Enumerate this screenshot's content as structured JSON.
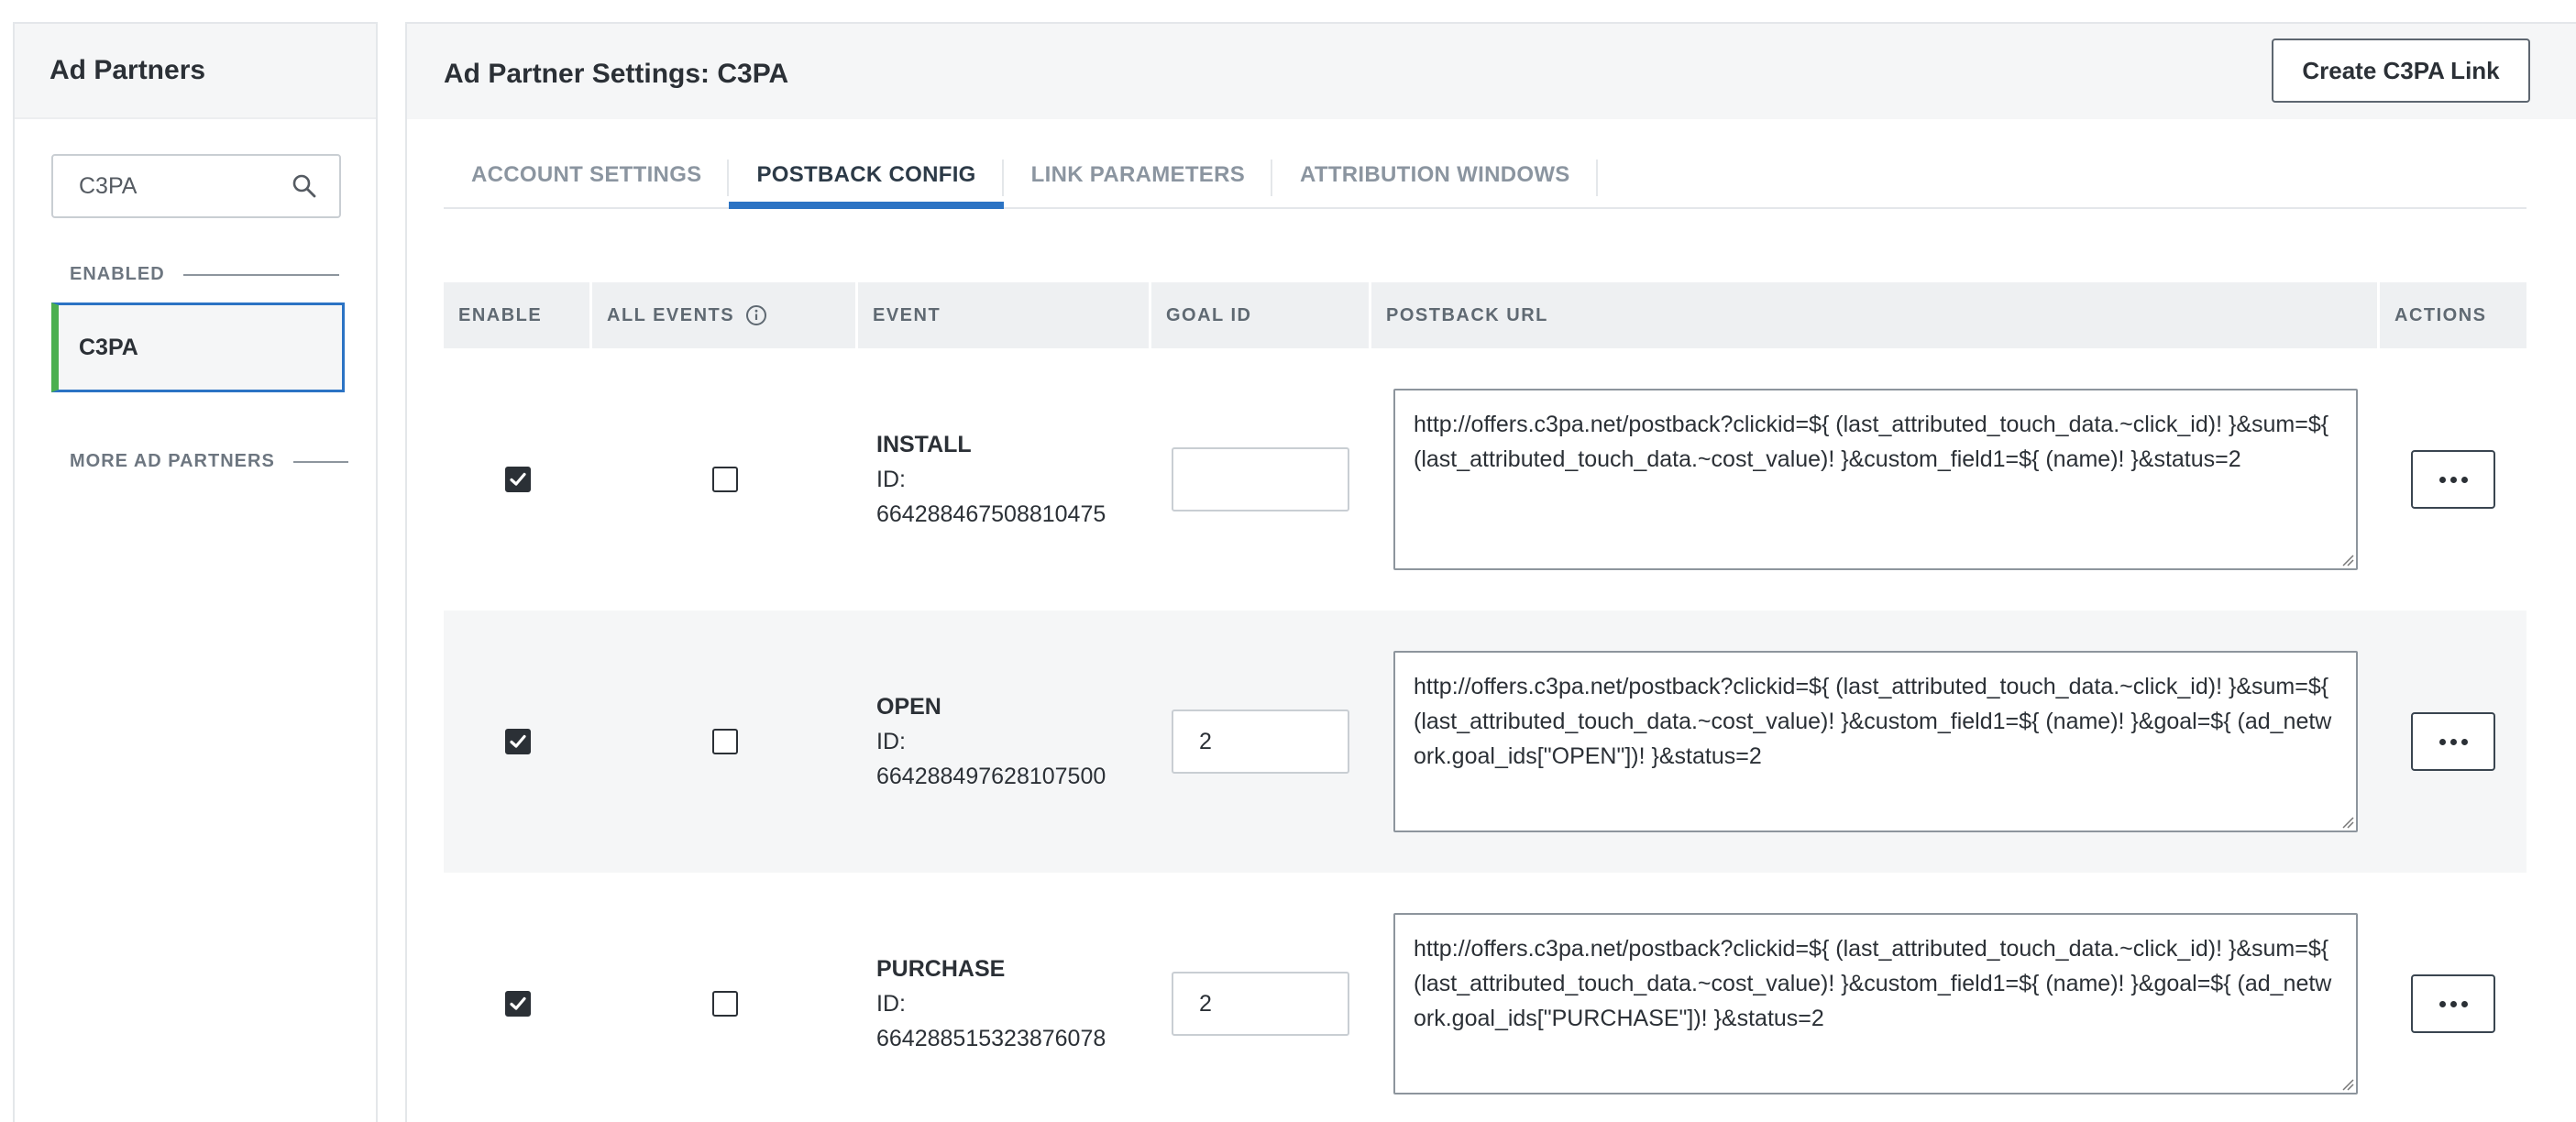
{
  "sidebar": {
    "title": "Ad Partners",
    "search": {
      "value": "C3PA",
      "icon": "search-icon"
    },
    "enabled_label": "ENABLED",
    "enabled_items": [
      {
        "label": "C3PA",
        "selected": true,
        "status_color": "#4caf50"
      }
    ],
    "more_label": "MORE AD PARTNERS"
  },
  "main": {
    "title": "Ad Partner Settings: C3PA",
    "create_button": "Create C3PA Link",
    "tabs": [
      {
        "label": "ACCOUNT SETTINGS",
        "active": false
      },
      {
        "label": "POSTBACK CONFIG",
        "active": true
      },
      {
        "label": "LINK PARAMETERS",
        "active": false
      },
      {
        "label": "ATTRIBUTION WINDOWS",
        "active": false
      }
    ],
    "accent_color": "#2b73c4",
    "table": {
      "headers": {
        "enable": "ENABLE",
        "all_events": "ALL EVENTS",
        "event": "EVENT",
        "goal_id": "GOAL ID",
        "postback_url": "POSTBACK URL",
        "actions": "ACTIONS"
      },
      "rows": [
        {
          "enabled": true,
          "all_events": false,
          "event_name": "INSTALL",
          "id_label": "ID:",
          "event_id": "664288467508810475",
          "goal_id": "",
          "postback_url": "http://offers.c3pa.net/postback?clickid=${ (last_attributed_touch_data.~click_id)! }&sum=${ (last_attributed_touch_data.~cost_value)! }&custom_field1=${ (name)! }&status=2"
        },
        {
          "enabled": true,
          "all_events": false,
          "event_name": "OPEN",
          "id_label": "ID:",
          "event_id": "664288497628107500",
          "goal_id": "2",
          "postback_url": "http://offers.c3pa.net/postback?clickid=${ (last_attributed_touch_data.~click_id)! }&sum=${ (last_attributed_touch_data.~cost_value)! }&custom_field1=${ (name)! }&goal=${ (ad_network.goal_ids[\"OPEN\"])! }&status=2"
        },
        {
          "enabled": true,
          "all_events": false,
          "event_name": "PURCHASE",
          "id_label": "ID:",
          "event_id": "664288515323876078",
          "goal_id": "2",
          "postback_url": "http://offers.c3pa.net/postback?clickid=${ (last_attributed_touch_data.~click_id)! }&sum=${ (last_attributed_touch_data.~cost_value)! }&custom_field1=${ (name)! }&goal=${ (ad_network.goal_ids[\"PURCHASE\"])! }&status=2"
        }
      ]
    }
  }
}
